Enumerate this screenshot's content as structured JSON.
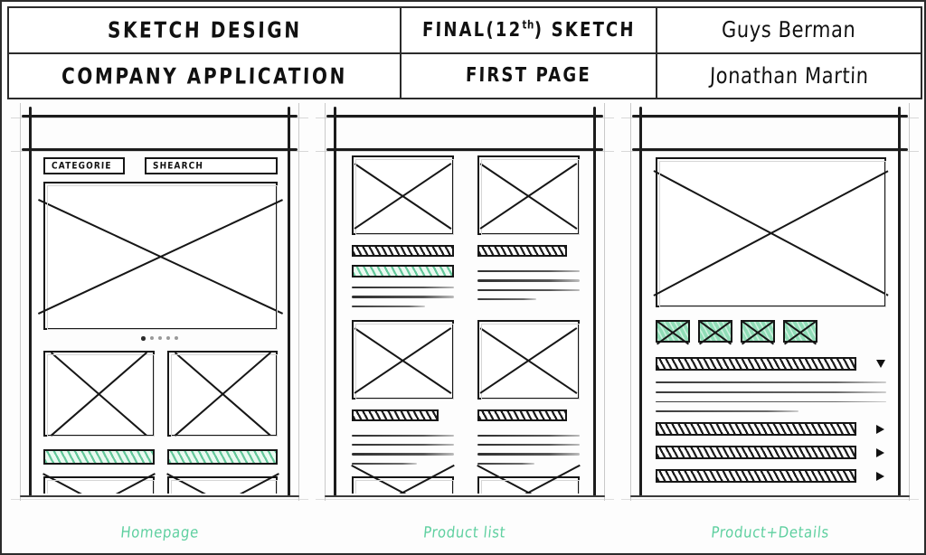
{
  "titleblock": {
    "row1": {
      "project": "SKETCH DESIGN",
      "revision_prefix": "FINAL(12",
      "revision_sup": "th",
      "revision_suffix": ") SKETCH",
      "author": "Guys Berman"
    },
    "row2": {
      "subject": "COMPANY APPLICATION",
      "sheet": "FIRST PAGE",
      "reviewer": "Jonathan Martin"
    }
  },
  "colors": {
    "accent_green": "#5fd0a0",
    "green_fill": "#8fdcb6",
    "ink": "#161616",
    "paper": "#ffffff"
  },
  "panels": [
    {
      "id": "homepage",
      "caption": "Homepage",
      "menu_icon": "hamburger-icon",
      "fields": [
        {
          "name": "category-field",
          "value": "CATEGORIE"
        },
        {
          "name": "search-field",
          "value": "SHEARCH"
        }
      ],
      "hero": {
        "name": "hero-image-placeholder",
        "type": "image-placeholder"
      },
      "carousel": {
        "dots": 5,
        "active_index": 0
      },
      "cards": [
        {
          "image": "image-placeholder",
          "button": "green-cta-bar",
          "footer": "image-placeholder"
        },
        {
          "image": "image-placeholder",
          "button": "green-cta-bar",
          "footer": "image-placeholder"
        }
      ]
    },
    {
      "id": "product-list",
      "caption": "Product list",
      "menu_icon": "hamburger-icon",
      "rows": [
        {
          "cards": [
            {
              "image": "image-placeholder",
              "title": "hatched-title-bar",
              "cta": "green-cta-bar",
              "lines": 3
            },
            {
              "image": "image-placeholder",
              "title": "hatched-title-bar",
              "cta": null,
              "lines": 4
            }
          ]
        },
        {
          "cards": [
            {
              "image": "image-placeholder",
              "title": "hatched-title-bar",
              "cta": null,
              "lines": 4
            },
            {
              "image": "image-placeholder",
              "title": "hatched-title-bar",
              "cta": null,
              "lines": 4
            }
          ]
        }
      ]
    },
    {
      "id": "product-details",
      "caption": "Product+Details",
      "close_icon": "close-icon",
      "hero": {
        "name": "product-hero-image",
        "type": "image-placeholder"
      },
      "thumbnails": 4,
      "summary": {
        "bar": "hatched-bar",
        "icon": "chevron-down-icon"
      },
      "description_lines": 4,
      "accordion_rows": [
        {
          "bar": "hatched-bar",
          "icon": "chevron-right-icon"
        },
        {
          "bar": "hatched-bar",
          "icon": "chevron-right-icon"
        },
        {
          "bar": "hatched-bar",
          "icon": "chevron-right-icon"
        }
      ]
    }
  ]
}
